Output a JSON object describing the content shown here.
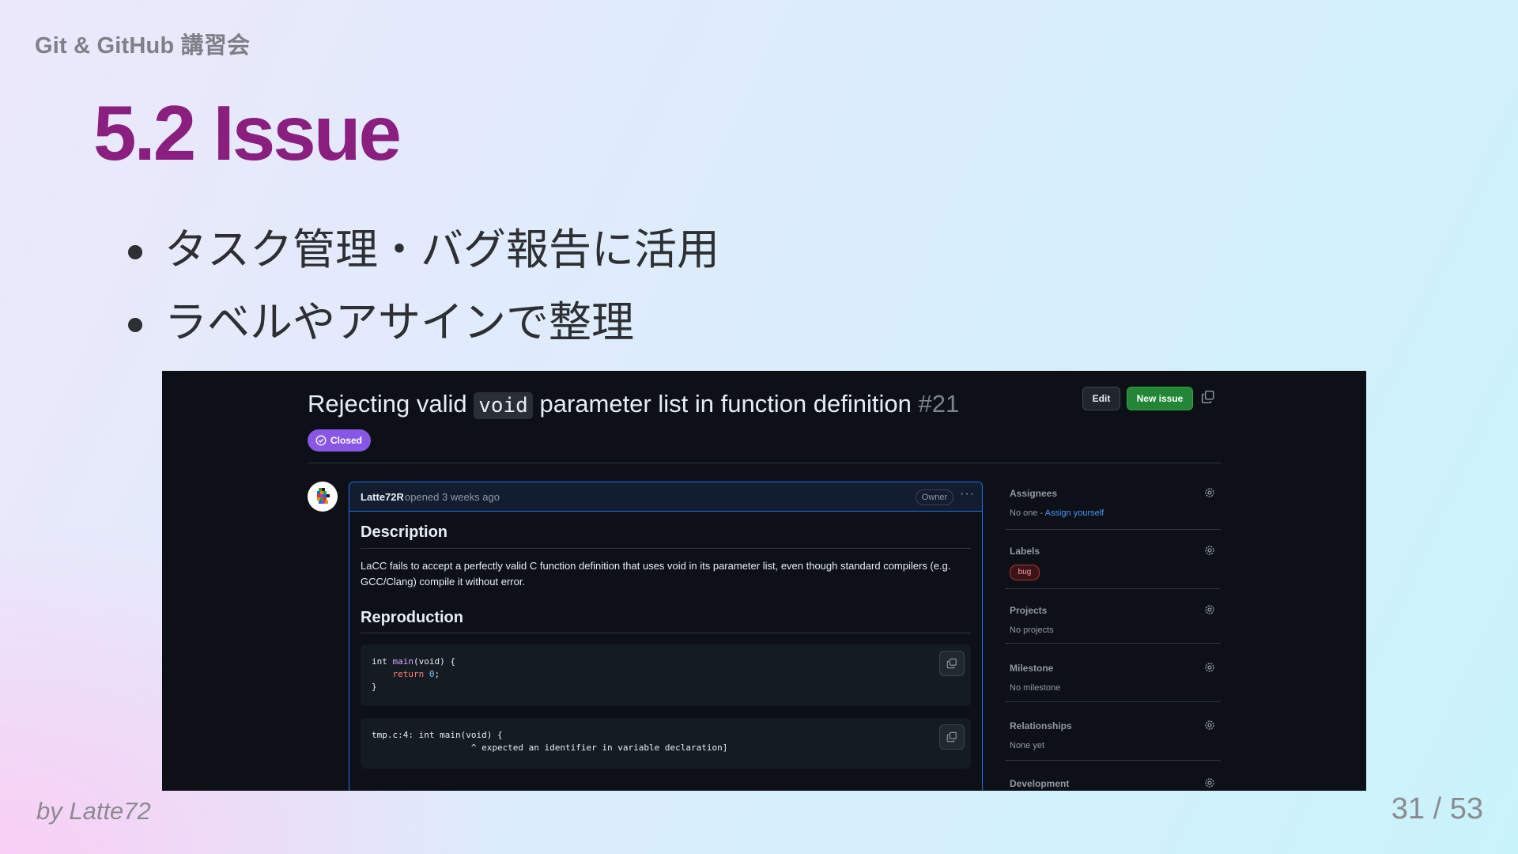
{
  "slide": {
    "header": "Git & GitHub 講習会",
    "title": "5.2 Issue",
    "bullets": [
      "タスク管理・バグ報告に活用",
      "ラベルやアサインで整理"
    ],
    "footer_author": "by Latte72",
    "page": "31 / 53"
  },
  "issue": {
    "title_before": "Rejecting valid ",
    "title_code": "void",
    "title_after": " parameter list in function definition",
    "number": "#21",
    "edit_label": "Edit",
    "new_issue_label": "New issue",
    "state": "Closed",
    "author": "Latte72R",
    "opened": "opened 3 weeks ago",
    "owner_badge": "Owner",
    "more_menu": "···",
    "description_heading": "Description",
    "description_text": "LaCC fails to accept a perfectly valid C function definition that uses void in its parameter list, even though standard compilers (e.g. GCC/Clang) compile it without error.",
    "reproduction_heading": "Reproduction",
    "code1": {
      "line1_type": "int ",
      "line1_fn": "main",
      "line1_rest": "(void) {",
      "line2_indent": "    ",
      "line2_kw": "return ",
      "line2_num": "0",
      "line2_end": ";",
      "line3": "}"
    },
    "code2": {
      "line1": "tmp.c:4: int main(void) {",
      "line2": "                   ^ expected an identifier in variable declaration]"
    }
  },
  "sidebar": {
    "assignees_title": "Assignees",
    "assignees_value": "No one - ",
    "assignees_link": "Assign yourself",
    "labels_title": "Labels",
    "label_bug": "bug",
    "projects_title": "Projects",
    "projects_value": "No projects",
    "milestone_title": "Milestone",
    "milestone_value": "No milestone",
    "relationships_title": "Relationships",
    "relationships_value": "None yet",
    "development_title": "Development"
  },
  "colors": {
    "title_accent": "#8a1f7f",
    "closed_badge": "#8957e5",
    "new_issue_green": "#238636",
    "link_blue": "#4493f8",
    "bug_label": "#b0323a"
  }
}
